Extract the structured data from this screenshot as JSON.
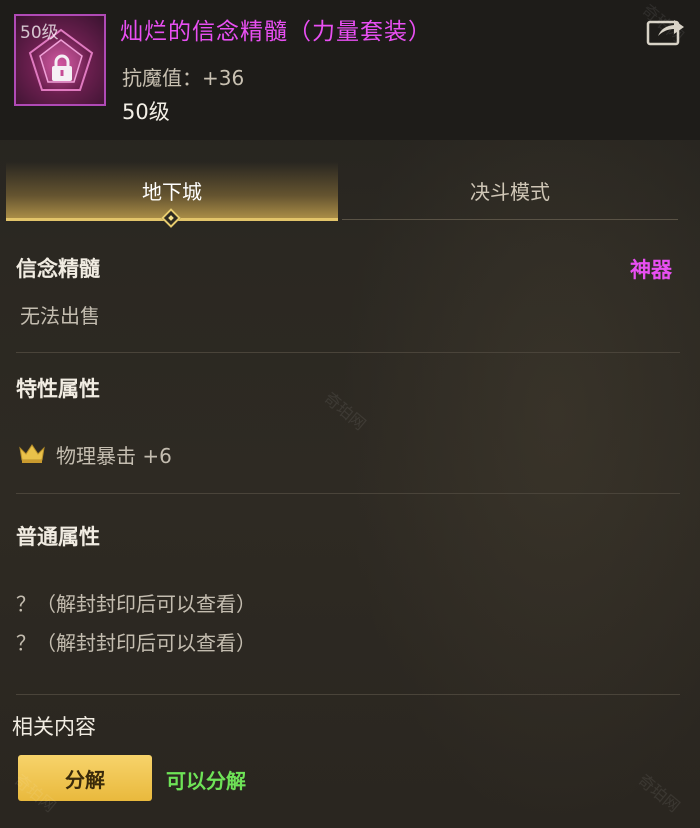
{
  "header": {
    "icon_level": "50级",
    "item_name": "灿烂的信念精髓（力量套装）",
    "stat": "抗魔值：+36",
    "level": "50级",
    "icons": {
      "lock": "lock-icon",
      "share": "share-icon"
    },
    "name_color": "#e84ff2"
  },
  "tabs": [
    {
      "label": "地下城",
      "active": true
    },
    {
      "label": "决斗模式",
      "active": false
    }
  ],
  "info": {
    "category": "信念精髓",
    "rarity": "神器",
    "sell": "无法出售"
  },
  "trait": {
    "title": "特性属性",
    "attribute": "物理暴击 +6",
    "icon": "crown-icon"
  },
  "normal": {
    "title": "普通属性",
    "lines": [
      "？（解封封印后可以查看）",
      "？（解封封印后可以查看）"
    ]
  },
  "related": {
    "title": "相关内容",
    "button_label": "分解",
    "status": "可以分解",
    "status_color": "#6ee357"
  },
  "watermark": "奇珀网"
}
